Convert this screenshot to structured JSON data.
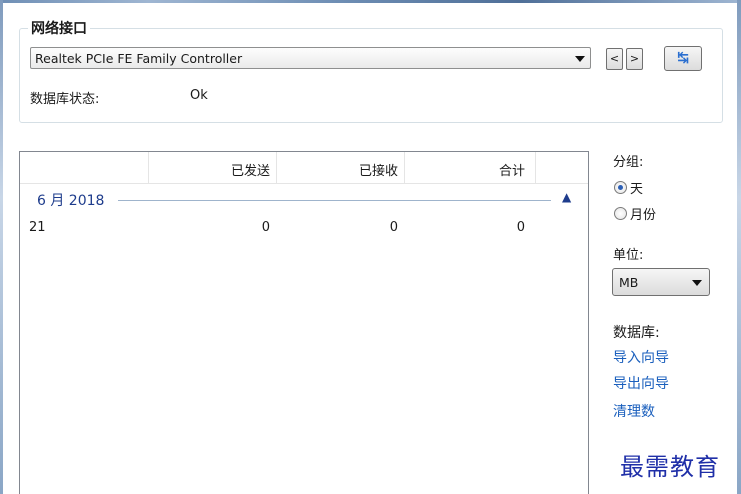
{
  "interface": {
    "title": "网络接口",
    "selected": "Realtek PCIe FE Family Controller",
    "prev_label": "<",
    "next_label": ">",
    "refresh_label": "↹",
    "status_label": "数据库状态:",
    "status_value": "Ok"
  },
  "table": {
    "columns": [
      "",
      "已发送",
      "已接收",
      "合计"
    ],
    "group": "6 月 2018",
    "rows": [
      {
        "date": "21",
        "sent": "0",
        "received": "0",
        "total": "0"
      }
    ]
  },
  "side": {
    "group_label": "分组:",
    "options": [
      {
        "label": "天",
        "checked": true
      },
      {
        "label": "月份",
        "checked": false
      }
    ],
    "unit_label": "单位:",
    "unit_value": "MB",
    "db_label": "数据库:",
    "links": [
      "导入向导",
      "导出向导",
      "清理数"
    ]
  },
  "watermark": "最需教育",
  "icons": {
    "dropdown": "chevron-down-icon",
    "refresh": "swap-arrows-icon",
    "collapse": "chevron-up-icon"
  }
}
